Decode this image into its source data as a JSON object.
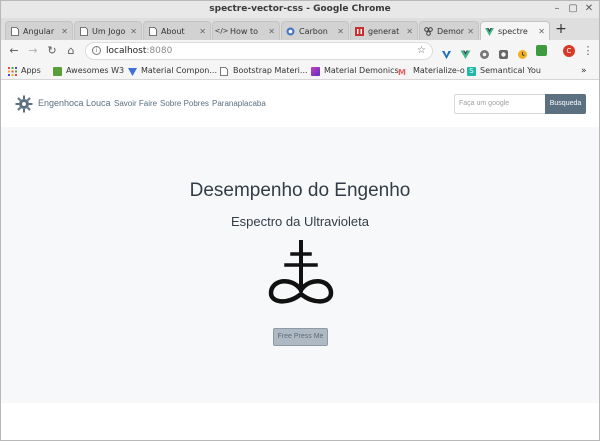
{
  "window": {
    "title": "spectre-vector-css - Google Chrome"
  },
  "tabs": [
    {
      "label": "Angular",
      "icon": "page-icon"
    },
    {
      "label": "Um Jogo",
      "icon": "page-icon"
    },
    {
      "label": "About",
      "icon": "page-icon"
    },
    {
      "label": "How to",
      "icon": "code-icon"
    },
    {
      "label": "Carbon",
      "icon": "carbon-icon"
    },
    {
      "label": "generat",
      "icon": "red-square-icon"
    },
    {
      "label": "Demon",
      "icon": "cluster-icon"
    },
    {
      "label": "spectre",
      "icon": "vue-icon"
    }
  ],
  "address": {
    "host": "localhost",
    "port": ":8080"
  },
  "bookmarks": [
    {
      "label": "Apps",
      "color": "#e44"
    },
    {
      "label": "Awesomes W3",
      "color": "#5a9e3a"
    },
    {
      "label": "Material Compon...",
      "color": "#3f6fd8"
    },
    {
      "label": "Bootstrap Materi...",
      "color": "#777777"
    },
    {
      "label": "Material Demonics",
      "color": "#8a3fb8"
    },
    {
      "label": "Materialize-o",
      "color": "#e06060"
    },
    {
      "label": "Semantical You",
      "color": "#22b8a8"
    }
  ],
  "site": {
    "brand": "Engenhoca Louca",
    "nav": [
      "Savoir Faire",
      "Sobre Pobres",
      "Paranaplacaba"
    ],
    "search_placeholder": "Faça um google",
    "search_button": "Busqueda"
  },
  "hero": {
    "title": "Desempenho do Engenho",
    "subtitle": "Espectro da Ultravioleta",
    "button": "Free Press Me"
  },
  "colors": {
    "accent": "#5b7080",
    "hero_bg": "#f7f8f9"
  }
}
